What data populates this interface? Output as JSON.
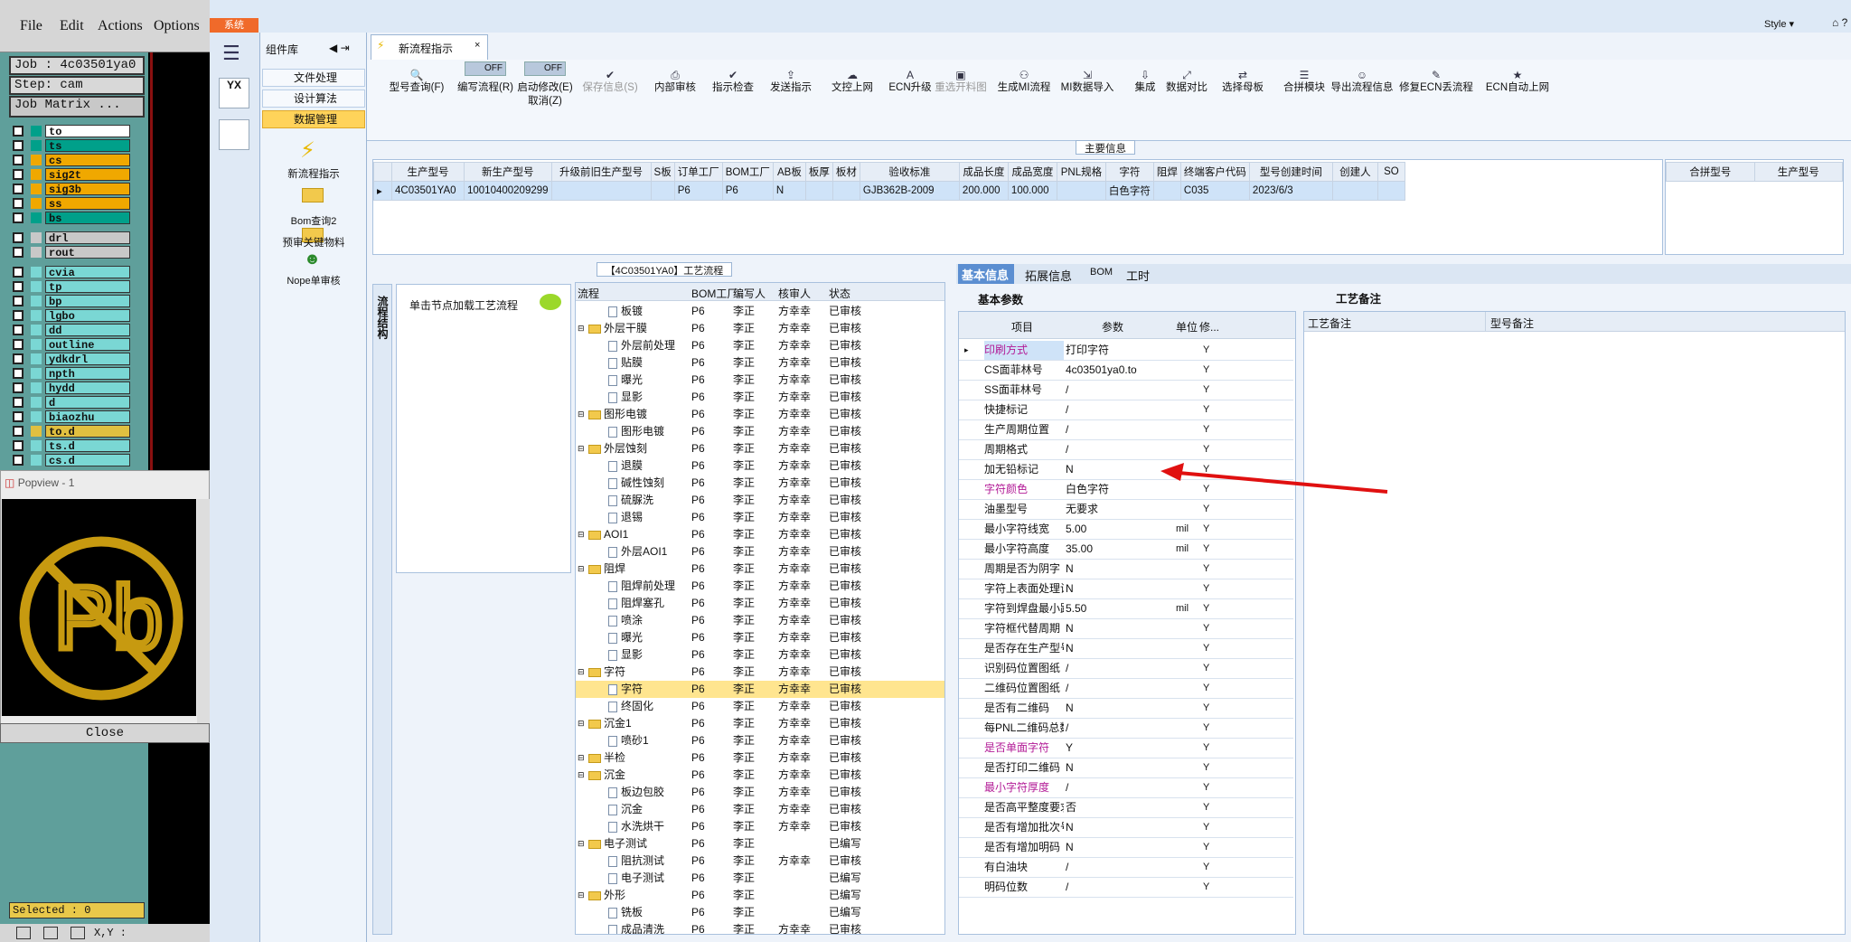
{
  "cam": {
    "menu": [
      {
        "label": "File"
      },
      {
        "label": "Edit"
      },
      {
        "label": "Actions"
      },
      {
        "label": "Options"
      }
    ],
    "job": "Job : 4c03501ya0",
    "step": "Step: cam",
    "job_matrix": "Job Matrix ...",
    "layers": [
      {
        "name": "to",
        "color": "#ffffff"
      },
      {
        "name": "ts",
        "color": "#00a08a"
      },
      {
        "name": "cs",
        "color": "#f0a800"
      },
      {
        "name": "sig2t",
        "color": "#f0a800"
      },
      {
        "name": "sig3b",
        "color": "#f0a800"
      },
      {
        "name": "ss",
        "color": "#f0a800"
      },
      {
        "name": "bs",
        "color": "#00a08a"
      },
      {
        "name": "drl",
        "color": "#c8c8c8"
      },
      {
        "name": "rout",
        "color": "#c8c8c8"
      },
      {
        "name": "cvia",
        "color": "#7ad7d4"
      },
      {
        "name": "tp",
        "color": "#7ad7d4"
      },
      {
        "name": "bp",
        "color": "#7ad7d4"
      },
      {
        "name": "lgbo",
        "color": "#7ad7d4"
      },
      {
        "name": "dd",
        "color": "#7ad7d4"
      },
      {
        "name": "outline",
        "color": "#7ad7d4"
      },
      {
        "name": "ydkdrl",
        "color": "#7ad7d4"
      },
      {
        "name": "npth",
        "color": "#7ad7d4"
      },
      {
        "name": "hydd",
        "color": "#7ad7d4"
      },
      {
        "name": "d",
        "color": "#7ad7d4"
      },
      {
        "name": "biaozhu",
        "color": "#7ad7d4"
      },
      {
        "name": "to.d",
        "color": "#e0c040"
      },
      {
        "name": "ts.d",
        "color": "#7ad7d4"
      },
      {
        "name": "cs.d",
        "color": "#7ad7d4"
      }
    ],
    "popview_title": "Popview - 1",
    "close": "Close",
    "selected": "Selected : 0",
    "xy": "X,Y :"
  },
  "app": {
    "system_tab": "系统",
    "style": "Style",
    "component_lib": "组件库",
    "side_items": [
      {
        "label": "文件处理"
      },
      {
        "label": "设计算法"
      },
      {
        "label": "数据管理"
      }
    ],
    "side_tools": [
      {
        "label": "新流程指示"
      },
      {
        "label": "Bom查询2"
      },
      {
        "label": "预审关键物料"
      },
      {
        "label": "Nope单审核"
      }
    ],
    "doc_tab": "新流程指示",
    "toolbar": [
      {
        "label": "型号查询(F)",
        "icon": "search-icon"
      },
      {
        "label": "编写流程(R)",
        "icon": "toggle"
      },
      {
        "label": "启动修改(E)",
        "sub": "取消(Z)",
        "icon": "toggle"
      },
      {
        "label": "保存信息(S)",
        "icon": "check-icon",
        "disabled": true
      },
      {
        "label": "内部审核",
        "icon": "print-icon"
      },
      {
        "label": "指示检查",
        "icon": "check-icon"
      },
      {
        "label": "发送指示",
        "icon": "upload-icon"
      },
      {
        "label": "文控上网",
        "icon": "cloud-icon"
      },
      {
        "label": "ECN升级",
        "icon": "font-icon"
      },
      {
        "label": "重选开料图",
        "icon": "image-icon",
        "disabled": true
      },
      {
        "label": "生成MI流程",
        "icon": "share-icon"
      },
      {
        "label": "MI数据导入",
        "icon": "import-icon"
      },
      {
        "label": "集成",
        "icon": "download-icon"
      },
      {
        "label": "数据对比",
        "icon": "compare-icon"
      },
      {
        "label": "选择母板",
        "icon": "shuffle-icon"
      },
      {
        "label": "合拼模块",
        "icon": "list-icon"
      },
      {
        "label": "导出流程信息",
        "icon": "smile-icon"
      },
      {
        "label": "修复ECN丢流程",
        "icon": "wrench-icon"
      },
      {
        "label": "ECN自动上网",
        "icon": "star-icon"
      }
    ],
    "toggle_off": "OFF",
    "main_info_title": "主要信息",
    "main_cols": [
      "生产型号",
      "新生产型号",
      "升级前旧生产型号",
      "S板",
      "订单工厂",
      "BOM工厂",
      "AB板",
      "板厚",
      "板材",
      "验收标准",
      "成品长度",
      "成品宽度",
      "PNL规格",
      "字符",
      "阻焊",
      "终端客户代码",
      "型号创建时间",
      "创建人",
      "SO"
    ],
    "main_row": [
      "4C03501YA0",
      "10010400209299",
      "",
      "",
      "P6",
      "P6",
      "N",
      "",
      "",
      "GJB362B-2009",
      "200.000",
      "100.000",
      "",
      "白色字符",
      "",
      "C035",
      "2023/6/3",
      "",
      ""
    ],
    "merge_cols": [
      "合拼型号",
      "生产型号"
    ],
    "process_title": "【4C03501YA0】工艺流程",
    "vertical_label": "流程结构",
    "click_hint": "单击节点加载工艺流程",
    "tree_cols": [
      "流程",
      "BOM工厂",
      "编写人",
      "核审人",
      "状态"
    ],
    "tree": [
      {
        "level": 2,
        "type": "doc",
        "name": "板镀",
        "bom": "P6",
        "w": "李正",
        "r": "方幸幸",
        "s": "已审核"
      },
      {
        "level": 1,
        "type": "folder",
        "name": "外层干膜",
        "bom": "P6",
        "w": "李正",
        "r": "方幸幸",
        "s": "已审核"
      },
      {
        "level": 2,
        "type": "doc",
        "name": "外层前处理",
        "bom": "P6",
        "w": "李正",
        "r": "方幸幸",
        "s": "已审核"
      },
      {
        "level": 2,
        "type": "doc",
        "name": "贴膜",
        "bom": "P6",
        "w": "李正",
        "r": "方幸幸",
        "s": "已审核"
      },
      {
        "level": 2,
        "type": "doc",
        "name": "曝光",
        "bom": "P6",
        "w": "李正",
        "r": "方幸幸",
        "s": "已审核"
      },
      {
        "level": 2,
        "type": "doc",
        "name": "显影",
        "bom": "P6",
        "w": "李正",
        "r": "方幸幸",
        "s": "已审核"
      },
      {
        "level": 1,
        "type": "folder",
        "name": "图形电镀",
        "bom": "P6",
        "w": "李正",
        "r": "方幸幸",
        "s": "已审核"
      },
      {
        "level": 2,
        "type": "doc",
        "name": "图形电镀",
        "bom": "P6",
        "w": "李正",
        "r": "方幸幸",
        "s": "已审核"
      },
      {
        "level": 1,
        "type": "folder",
        "name": "外层蚀刻",
        "bom": "P6",
        "w": "李正",
        "r": "方幸幸",
        "s": "已审核"
      },
      {
        "level": 2,
        "type": "doc",
        "name": "退膜",
        "bom": "P6",
        "w": "李正",
        "r": "方幸幸",
        "s": "已审核"
      },
      {
        "level": 2,
        "type": "doc",
        "name": "碱性蚀刻",
        "bom": "P6",
        "w": "李正",
        "r": "方幸幸",
        "s": "已审核"
      },
      {
        "level": 2,
        "type": "doc",
        "name": "硫脲洗",
        "bom": "P6",
        "w": "李正",
        "r": "方幸幸",
        "s": "已审核"
      },
      {
        "level": 2,
        "type": "doc",
        "name": "退锡",
        "bom": "P6",
        "w": "李正",
        "r": "方幸幸",
        "s": "已审核"
      },
      {
        "level": 1,
        "type": "folder",
        "name": "AOI1",
        "bom": "P6",
        "w": "李正",
        "r": "方幸幸",
        "s": "已审核"
      },
      {
        "level": 2,
        "type": "doc",
        "name": "外层AOI1",
        "bom": "P6",
        "w": "李正",
        "r": "方幸幸",
        "s": "已审核"
      },
      {
        "level": 1,
        "type": "folder",
        "name": "阻焊",
        "bom": "P6",
        "w": "李正",
        "r": "方幸幸",
        "s": "已审核"
      },
      {
        "level": 2,
        "type": "doc",
        "name": "阻焊前处理",
        "bom": "P6",
        "w": "李正",
        "r": "方幸幸",
        "s": "已审核"
      },
      {
        "level": 2,
        "type": "doc",
        "name": "阻焊塞孔",
        "bom": "P6",
        "w": "李正",
        "r": "方幸幸",
        "s": "已审核"
      },
      {
        "level": 2,
        "type": "doc",
        "name": "喷涂",
        "bom": "P6",
        "w": "李正",
        "r": "方幸幸",
        "s": "已审核"
      },
      {
        "level": 2,
        "type": "doc",
        "name": "曝光",
        "bom": "P6",
        "w": "李正",
        "r": "方幸幸",
        "s": "已审核"
      },
      {
        "level": 2,
        "type": "doc",
        "name": "显影",
        "bom": "P6",
        "w": "李正",
        "r": "方幸幸",
        "s": "已审核"
      },
      {
        "level": 1,
        "type": "folder",
        "name": "字符",
        "bom": "P6",
        "w": "李正",
        "r": "方幸幸",
        "s": "已审核"
      },
      {
        "level": 2,
        "type": "doc",
        "name": "字符",
        "bom": "P6",
        "w": "李正",
        "r": "方幸幸",
        "s": "已审核",
        "selected": true
      },
      {
        "level": 2,
        "type": "doc",
        "name": "终固化",
        "bom": "P6",
        "w": "李正",
        "r": "方幸幸",
        "s": "已审核"
      },
      {
        "level": 1,
        "type": "folder",
        "name": "沉金1",
        "bom": "P6",
        "w": "李正",
        "r": "方幸幸",
        "s": "已审核"
      },
      {
        "level": 2,
        "type": "doc",
        "name": "喷砂1",
        "bom": "P6",
        "w": "李正",
        "r": "方幸幸",
        "s": "已审核"
      },
      {
        "level": 1,
        "type": "folder",
        "name": "半检",
        "bom": "P6",
        "w": "李正",
        "r": "方幸幸",
        "s": "已审核"
      },
      {
        "level": 1,
        "type": "folder",
        "name": "沉金",
        "bom": "P6",
        "w": "李正",
        "r": "方幸幸",
        "s": "已审核"
      },
      {
        "level": 2,
        "type": "doc",
        "name": "板边包胶",
        "bom": "P6",
        "w": "李正",
        "r": "方幸幸",
        "s": "已审核"
      },
      {
        "level": 2,
        "type": "doc",
        "name": "沉金",
        "bom": "P6",
        "w": "李正",
        "r": "方幸幸",
        "s": "已审核"
      },
      {
        "level": 2,
        "type": "doc",
        "name": "水洗烘干",
        "bom": "P6",
        "w": "李正",
        "r": "方幸幸",
        "s": "已审核"
      },
      {
        "level": 1,
        "type": "folder",
        "name": "电子测试",
        "bom": "P6",
        "w": "李正",
        "r": "",
        "s": "已编写"
      },
      {
        "level": 2,
        "type": "doc",
        "name": "阻抗测试",
        "bom": "P6",
        "w": "李正",
        "r": "方幸幸",
        "s": "已审核"
      },
      {
        "level": 2,
        "type": "doc",
        "name": "电子测试",
        "bom": "P6",
        "w": "李正",
        "r": "",
        "s": "已编写"
      },
      {
        "level": 1,
        "type": "folder",
        "name": "外形",
        "bom": "P6",
        "w": "李正",
        "r": "",
        "s": "已编写"
      },
      {
        "level": 2,
        "type": "doc",
        "name": "铣板",
        "bom": "P6",
        "w": "李正",
        "r": "",
        "s": "已编写"
      },
      {
        "level": 2,
        "type": "doc",
        "name": "成品清洗",
        "bom": "P6",
        "w": "李正",
        "r": "方幸幸",
        "s": "已审核"
      }
    ],
    "detail_tabs": [
      {
        "label": "基本信息"
      },
      {
        "label": "拓展信息"
      },
      {
        "label": "BOM"
      },
      {
        "label": "工时"
      }
    ],
    "basic_params_title": "基本参数",
    "param_cols": [
      "项目",
      "参数",
      "单位",
      "修..."
    ],
    "params": [
      {
        "item": "印刷方式",
        "value": "打印字符",
        "unit": "",
        "mod": "Y",
        "pink": true,
        "sel": true
      },
      {
        "item": "CS面菲林号",
        "value": "4c03501ya0.to",
        "unit": "",
        "mod": "Y"
      },
      {
        "item": "SS面菲林号",
        "value": "/",
        "unit": "",
        "mod": "Y"
      },
      {
        "item": "快捷标记",
        "value": "/",
        "unit": "",
        "mod": "Y"
      },
      {
        "item": "生产周期位置",
        "value": "/",
        "unit": "",
        "mod": "Y"
      },
      {
        "item": "周期格式",
        "value": "/",
        "unit": "",
        "mod": "Y"
      },
      {
        "item": "加无铅标记",
        "value": "N",
        "unit": "",
        "mod": "Y"
      },
      {
        "item": "字符颜色",
        "value": "白色字符",
        "unit": "",
        "mod": "Y",
        "pink": true
      },
      {
        "item": "油墨型号",
        "value": "无要求",
        "unit": "",
        "mod": "Y"
      },
      {
        "item": "最小字符线宽",
        "value": "5.00",
        "unit": "mil",
        "mod": "Y"
      },
      {
        "item": "最小字符高度",
        "value": "35.00",
        "unit": "mil",
        "mod": "Y"
      },
      {
        "item": "周期是否为阴字",
        "value": "N",
        "unit": "",
        "mod": "Y"
      },
      {
        "item": "字符上表面处理设计",
        "value": "N",
        "unit": "",
        "mod": "Y"
      },
      {
        "item": "字符到焊盘最小距离",
        "value": "5.50",
        "unit": "mil",
        "mod": "Y"
      },
      {
        "item": "字符框代替周期",
        "value": "N",
        "unit": "",
        "mod": "Y"
      },
      {
        "item": "是否存在生产型号",
        "value": "N",
        "unit": "",
        "mod": "Y"
      },
      {
        "item": "识别码位置图纸",
        "value": "/",
        "unit": "",
        "mod": "Y"
      },
      {
        "item": "二维码位置图纸",
        "value": "/",
        "unit": "",
        "mod": "Y"
      },
      {
        "item": "是否有二维码",
        "value": "N",
        "unit": "",
        "mod": "Y"
      },
      {
        "item": "每PNL二维码总数",
        "value": "/",
        "unit": "",
        "mod": "Y"
      },
      {
        "item": "是否单面字符",
        "value": "Y",
        "unit": "",
        "mod": "Y",
        "pink": true
      },
      {
        "item": "是否打印二维码",
        "value": "N",
        "unit": "",
        "mod": "Y"
      },
      {
        "item": "最小字符厚度",
        "value": "/",
        "unit": "",
        "mod": "Y",
        "pink": true
      },
      {
        "item": "是否高平整度要求",
        "value": "否",
        "unit": "",
        "mod": "Y"
      },
      {
        "item": "是否有增加批次号",
        "value": "N",
        "unit": "",
        "mod": "Y"
      },
      {
        "item": "是否有增加明码",
        "value": "N",
        "unit": "",
        "mod": "Y"
      },
      {
        "item": "有白油块",
        "value": "/",
        "unit": "",
        "mod": "Y"
      },
      {
        "item": "明码位数",
        "value": "/",
        "unit": "",
        "mod": "Y"
      }
    ],
    "notes_title": "工艺备注",
    "notes_cols": [
      "工艺备注",
      "型号备注"
    ],
    "arrow_color": "#e01010"
  }
}
